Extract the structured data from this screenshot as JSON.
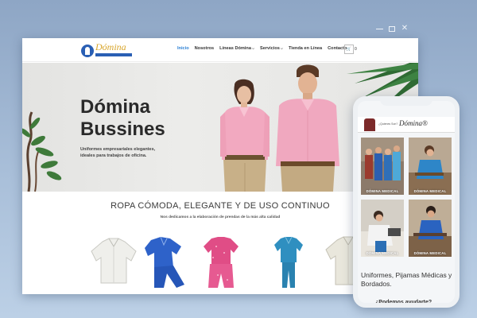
{
  "window": {
    "controls": [
      "minimize",
      "restore",
      "close"
    ]
  },
  "site": {
    "logo_text": "Dómina",
    "nav": [
      {
        "label": "Inicio",
        "active": true,
        "dropdown": false
      },
      {
        "label": "Nosotros",
        "active": false,
        "dropdown": false
      },
      {
        "label": "Líneas Dómina",
        "active": false,
        "dropdown": true
      },
      {
        "label": "Servicios",
        "active": false,
        "dropdown": true
      },
      {
        "label": "Tienda en Línea",
        "active": false,
        "dropdown": false
      },
      {
        "label": "Contacto",
        "active": false,
        "dropdown": false
      }
    ],
    "cart_count": "0",
    "hero": {
      "title_line1": "Dómina",
      "title_line2": "Bussines",
      "subtitle": "Uniformes empresariales elegantes, ideales para trabajos de oficina."
    },
    "section": {
      "title": "ROPA CÓMODA, ELEGANTE Y DE USO CONTINUO",
      "subtitle": "Nos dedicamos a la elaboración de prendas de la más alta calidad"
    },
    "products": [
      {
        "name": "white-blouse",
        "color": "#eeeeea"
      },
      {
        "name": "blue-pajama",
        "color": "#2e62c9"
      },
      {
        "name": "pink-pajama",
        "color": "#e04d86"
      },
      {
        "name": "teal-scrubs",
        "color": "#2f8fc0"
      },
      {
        "name": "cream-shirt",
        "color": "#e9e7dc"
      }
    ]
  },
  "mobile": {
    "logo_text": "Dómina®",
    "header_sub": "¿Quienes Son?",
    "cards": [
      {
        "caption": "DÓMINA MEDICAL"
      },
      {
        "caption": "DÓMINA MEDICAL"
      },
      {
        "caption": "DÓMINA MEDICAL"
      },
      {
        "caption": "DÓMINA MEDICAL"
      }
    ],
    "text": "Uniformes, Pijamas Médicas y Bordados.",
    "text2": "¿Podemos ayudarte?"
  },
  "colors": {
    "accent": "#2a7fd4",
    "brand_blue": "#2a5fb4",
    "brand_gold": "#d8a52a"
  }
}
